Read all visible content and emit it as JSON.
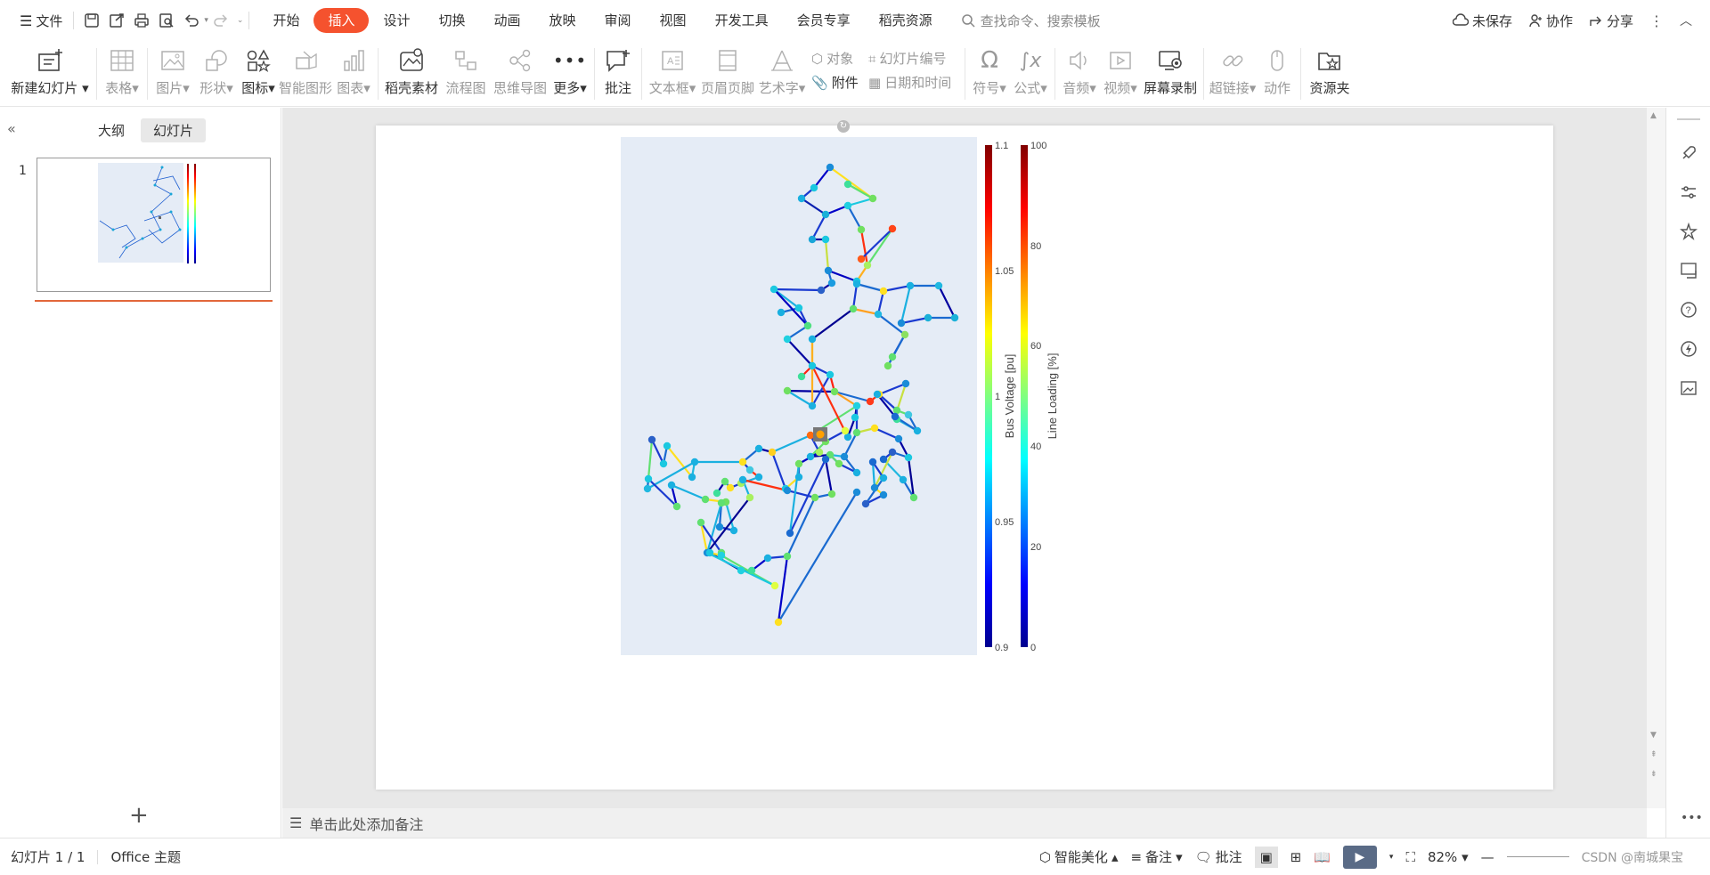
{
  "titlebar": {
    "menu_label": "文件",
    "tabs": [
      "开始",
      "插入",
      "设计",
      "切换",
      "动画",
      "放映",
      "审阅",
      "视图",
      "开发工具",
      "会员专享",
      "稻壳资源"
    ],
    "active_tab": "插入",
    "search_placeholder": "查找命令、搜索模板",
    "unsaved": "未保存",
    "collab": "协作",
    "share": "分享"
  },
  "ribbon": {
    "new_slide": "新建幻灯片",
    "table": "表格",
    "picture": "图片",
    "shape": "形状",
    "icon": "图标",
    "smartart": "智能图形",
    "chart": "图表",
    "daoke": "稻壳素材",
    "flowchart": "流程图",
    "mindmap": "思维导图",
    "more": "更多",
    "comment": "批注",
    "textbox": "文本框",
    "header_footer": "页眉页脚",
    "wordart": "艺术字",
    "object": "对象",
    "attachment": "附件",
    "slide_number": "幻灯片编号",
    "datetime": "日期和时间",
    "symbol": "符号",
    "formula": "公式",
    "audio": "音频",
    "video": "视频",
    "screen_record": "屏幕录制",
    "hyperlink": "超链接",
    "action": "动作",
    "resources": "资源夹"
  },
  "leftpanel": {
    "tab_outline": "大纲",
    "tab_slides": "幻灯片",
    "slide_number": "1"
  },
  "chart": {
    "voltage_title": "Bus Voltage [pu]",
    "voltage_ticks": [
      "1.1",
      "1.05",
      "1",
      "0.95",
      "0.9"
    ],
    "loading_title": "Line Loading [%]",
    "loading_ticks": [
      "100",
      "80",
      "60",
      "40",
      "20",
      "0"
    ]
  },
  "chart_data": {
    "type": "scatter",
    "title": "",
    "colorbars": [
      {
        "title": "Bus Voltage [pu]",
        "range": [
          0.9,
          1.1
        ],
        "ticks": [
          0.9,
          0.95,
          1,
          1.05,
          1.1
        ],
        "colorscale": "jet"
      },
      {
        "title": "Line Loading [%]",
        "range": [
          0,
          100
        ],
        "ticks": [
          0,
          20,
          40,
          60,
          80,
          100
        ],
        "colorscale": "jet"
      }
    ],
    "background": "#e5ecf6"
  },
  "notes": {
    "placeholder": "单击此处添加备注"
  },
  "statusbar": {
    "slide_info": "幻灯片 1 / 1",
    "theme": "Office 主题",
    "beautify": "智能美化",
    "notes": "备注",
    "comment": "批注",
    "zoom": "82%",
    "watermark": "CSDN @南城果宝"
  },
  "colors": {
    "accent": "#f5522e",
    "plot_bg": "#e5ecf6"
  }
}
